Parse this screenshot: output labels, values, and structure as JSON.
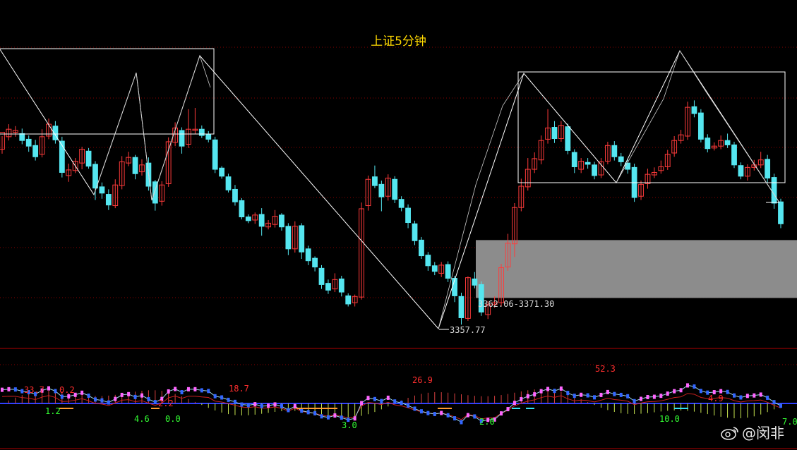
{
  "title": "上证5分钟",
  "zone_label": "3362.06-3371.30",
  "low_label": "3357.77",
  "watermark": "@闵非",
  "colors": {
    "bg": "#000000",
    "up": "#ff3b3b",
    "down": "#55e6f0",
    "grid": "#8b0000",
    "frame": "#ffffff",
    "title": "#ffd800",
    "zone": "#8c8c8c",
    "ind_up": "#ff2e2e",
    "ind_down": "#55ff55",
    "ind_hist_up": "#d94040",
    "ind_hist_down": "#c8e650",
    "dot_up": "#ff66ff",
    "dot_down": "#3366ff"
  },
  "indicator_labels": [
    {
      "text": "33.7",
      "color": "red"
    },
    {
      "text": "0.2",
      "color": "red"
    },
    {
      "text": "1.2",
      "color": "green"
    },
    {
      "text": "2.2",
      "color": "red"
    },
    {
      "text": "4.6",
      "color": "green"
    },
    {
      "text": "0.0",
      "color": "green"
    },
    {
      "text": "18.7",
      "color": "red"
    },
    {
      "text": "3.0",
      "color": "green"
    },
    {
      "text": "26.9",
      "color": "red"
    },
    {
      "text": "2.0",
      "color": "green"
    },
    {
      "text": "52.3",
      "color": "red"
    },
    {
      "text": "4.9",
      "color": "red"
    },
    {
      "text": "10.0",
      "color": "green"
    },
    {
      "text": "7.0",
      "color": "green"
    }
  ],
  "chart_data": {
    "type": "candlestick",
    "y_min": 3354,
    "y_max": 3404,
    "zone": [
      3362.06,
      3371.3
    ],
    "low_mark": 3357.77,
    "candles": [
      [
        3385.8,
        3388.5,
        3387.9,
        3385.1
      ],
      [
        3387.8,
        3389.0,
        3389.8,
        3387.2
      ],
      [
        3388.5,
        3388.8,
        3389.5,
        3387.8
      ],
      [
        3388.3,
        3387.2,
        3389.1,
        3386.6
      ],
      [
        3387.4,
        3386.3,
        3388.0,
        3385.4
      ],
      [
        3386.4,
        3384.6,
        3387.3,
        3384.0
      ],
      [
        3385.0,
        3387.8,
        3389.0,
        3384.5
      ],
      [
        3387.9,
        3389.8,
        3390.7,
        3387.4
      ],
      [
        3389.5,
        3387.3,
        3390.3,
        3386.7
      ],
      [
        3387.1,
        3382.1,
        3387.8,
        3381.3
      ],
      [
        3381.6,
        3382.5,
        3383.5,
        3380.6
      ],
      [
        3382.4,
        3383.9,
        3384.4,
        3382.0
      ],
      [
        3383.6,
        3385.8,
        3386.2,
        3382.6
      ],
      [
        3385.5,
        3383.1,
        3386.0,
        3382.7
      ],
      [
        3383.4,
        3379.6,
        3383.9,
        3377.7
      ],
      [
        3379.8,
        3378.8,
        3380.5,
        3377.9
      ],
      [
        3378.6,
        3376.9,
        3379.4,
        3376.1
      ],
      [
        3376.8,
        3380.1,
        3381.0,
        3376.4
      ],
      [
        3380.0,
        3383.8,
        3384.7,
        3379.4
      ],
      [
        3383.6,
        3384.5,
        3385.4,
        3383.1
      ],
      [
        3384.5,
        3381.9,
        3384.9,
        3381.0
      ],
      [
        3382.2,
        3383.3,
        3384.2,
        3381.6
      ],
      [
        3383.6,
        3379.9,
        3384.5,
        3379.2
      ],
      [
        3380.6,
        3377.2,
        3380.9,
        3376.0
      ],
      [
        3377.5,
        3380.1,
        3380.7,
        3376.8
      ],
      [
        3380.3,
        3387.0,
        3387.7,
        3379.8
      ],
      [
        3386.9,
        3389.2,
        3390.1,
        3386.3
      ],
      [
        3388.8,
        3386.3,
        3389.3,
        3385.1
      ],
      [
        3386.6,
        3389.0,
        3392.2,
        3386.0
      ],
      [
        3388.8,
        3389.0,
        3392.4,
        3388.2
      ],
      [
        3389.0,
        3388.0,
        3389.6,
        3387.6
      ],
      [
        3388.2,
        3387.4,
        3388.7,
        3386.9
      ],
      [
        3387.3,
        3382.6,
        3387.8,
        3382.0
      ],
      [
        3382.8,
        3381.5,
        3383.1,
        3381.1
      ],
      [
        3381.4,
        3379.3,
        3381.9,
        3378.9
      ],
      [
        3379.4,
        3377.4,
        3380.1,
        3376.8
      ],
      [
        3377.6,
        3375.0,
        3378.0,
        3374.6
      ],
      [
        3375.0,
        3374.4,
        3375.4,
        3374.0
      ],
      [
        3374.5,
        3375.3,
        3375.7,
        3373.9
      ],
      [
        3375.4,
        3373.5,
        3376.4,
        3372.0
      ],
      [
        3373.4,
        3374.0,
        3374.5,
        3373.0
      ],
      [
        3373.8,
        3375.1,
        3376.1,
        3373.3
      ],
      [
        3375.3,
        3373.4,
        3375.6,
        3372.8
      ],
      [
        3373.5,
        3369.9,
        3374.0,
        3368.9
      ],
      [
        3369.9,
        3373.5,
        3374.3,
        3369.3
      ],
      [
        3373.6,
        3369.4,
        3374.0,
        3368.3
      ],
      [
        3369.9,
        3368.0,
        3370.4,
        3367.3
      ],
      [
        3368.4,
        3367.0,
        3368.7,
        3366.3
      ],
      [
        3366.8,
        3364.2,
        3367.3,
        3363.5
      ],
      [
        3364.4,
        3363.3,
        3365.0,
        3362.7
      ],
      [
        3363.5,
        3365.0,
        3366.0,
        3363.0
      ],
      [
        3365.1,
        3363.0,
        3365.6,
        3362.3
      ],
      [
        3362.4,
        3361.1,
        3362.8,
        3360.7
      ],
      [
        3361.3,
        3362.3,
        3362.6,
        3360.7
      ],
      [
        3362.2,
        3376.3,
        3377.3,
        3361.8
      ],
      [
        3376.8,
        3381.0,
        3381.6,
        3376.0
      ],
      [
        3381.4,
        3380.0,
        3383.2,
        3379.6
      ],
      [
        3380.2,
        3378.2,
        3380.8,
        3375.9
      ],
      [
        3378.3,
        3381.2,
        3381.8,
        3377.6
      ],
      [
        3381.0,
        3377.8,
        3381.5,
        3377.2
      ],
      [
        3377.8,
        3376.5,
        3378.3,
        3375.9
      ],
      [
        3376.4,
        3374.1,
        3377.0,
        3373.2
      ],
      [
        3373.9,
        3371.2,
        3374.4,
        3370.5
      ],
      [
        3371.3,
        3368.8,
        3371.8,
        3368.3
      ],
      [
        3368.9,
        3367.2,
        3369.4,
        3366.4
      ],
      [
        3367.2,
        3366.3,
        3367.8,
        3365.7
      ],
      [
        3366.0,
        3367.3,
        3367.8,
        3365.4
      ],
      [
        3367.4,
        3365.2,
        3367.9,
        3364.6
      ],
      [
        3365.2,
        3362.4,
        3365.6,
        3361.4
      ],
      [
        3362.3,
        3358.9,
        3362.9,
        3357.8
      ],
      [
        3358.8,
        3365.3,
        3365.5,
        3358.4
      ],
      [
        3365.1,
        3364.1,
        3366.2,
        3363.6
      ],
      [
        3364.2,
        3359.8,
        3364.7,
        3359.2
      ],
      [
        3359.4,
        3361.0,
        3361.6,
        3358.7
      ],
      [
        3361.0,
        3361.3,
        3362.3,
        3360.5
      ],
      [
        3361.3,
        3366.9,
        3367.5,
        3360.7
      ],
      [
        3367.0,
        3370.8,
        3372.3,
        3366.4
      ],
      [
        3370.7,
        3376.5,
        3377.2,
        3368.6
      ],
      [
        3376.5,
        3379.9,
        3381.1,
        3375.9
      ],
      [
        3379.8,
        3382.6,
        3384.4,
        3379.2
      ],
      [
        3382.6,
        3384.3,
        3385.3,
        3382.0
      ],
      [
        3384.1,
        3387.2,
        3388.0,
        3383.4
      ],
      [
        3387.4,
        3389.2,
        3392.2,
        3386.7
      ],
      [
        3389.3,
        3387.5,
        3390.3,
        3386.8
      ],
      [
        3387.5,
        3389.6,
        3390.3,
        3387.0
      ],
      [
        3389.4,
        3385.6,
        3389.9,
        3385.0
      ],
      [
        3385.3,
        3383.0,
        3385.8,
        3382.0
      ],
      [
        3382.6,
        3383.9,
        3384.4,
        3382.0
      ],
      [
        3383.7,
        3383.4,
        3384.4,
        3382.7
      ],
      [
        3383.3,
        3381.6,
        3383.8,
        3381.0
      ],
      [
        3381.7,
        3383.8,
        3384.4,
        3381.2
      ],
      [
        3383.9,
        3386.4,
        3387.0,
        3383.4
      ],
      [
        3386.4,
        3384.6,
        3387.1,
        3384.0
      ],
      [
        3384.6,
        3383.8,
        3385.2,
        3383.1
      ],
      [
        3383.6,
        3382.6,
        3384.3,
        3381.9
      ],
      [
        3382.9,
        3378.1,
        3383.5,
        3377.4
      ],
      [
        3378.3,
        3380.2,
        3380.8,
        3377.7
      ],
      [
        3380.3,
        3381.8,
        3382.7,
        3379.5
      ],
      [
        3381.7,
        3382.1,
        3382.9,
        3381.2
      ],
      [
        3382.4,
        3383.0,
        3384.0,
        3381.9
      ],
      [
        3383.0,
        3385.0,
        3385.7,
        3382.5
      ],
      [
        3385.2,
        3387.2,
        3387.9,
        3384.6
      ],
      [
        3387.2,
        3388.1,
        3388.9,
        3386.7
      ],
      [
        3387.9,
        3392.5,
        3393.4,
        3387.3
      ],
      [
        3392.6,
        3391.5,
        3393.6,
        3390.9
      ],
      [
        3391.6,
        3387.4,
        3392.2,
        3386.9
      ],
      [
        3387.6,
        3385.9,
        3388.2,
        3385.3
      ],
      [
        3386.0,
        3386.3,
        3386.9,
        3385.6
      ],
      [
        3386.3,
        3387.2,
        3388.0,
        3385.8
      ],
      [
        3387.2,
        3386.5,
        3388.3,
        3386.0
      ],
      [
        3386.5,
        3383.3,
        3387.0,
        3382.8
      ],
      [
        3383.2,
        3381.5,
        3383.7,
        3381.0
      ],
      [
        3381.5,
        3382.9,
        3383.4,
        3380.8
      ],
      [
        3382.9,
        3383.3,
        3384.1,
        3382.4
      ],
      [
        3383.3,
        3384.1,
        3385.4,
        3382.8
      ],
      [
        3384.2,
        3381.2,
        3384.9,
        3380.4
      ],
      [
        3381.3,
        3377.2,
        3381.9,
        3376.3
      ],
      [
        3377.4,
        3373.9,
        3377.9,
        3373.2
      ]
    ]
  }
}
